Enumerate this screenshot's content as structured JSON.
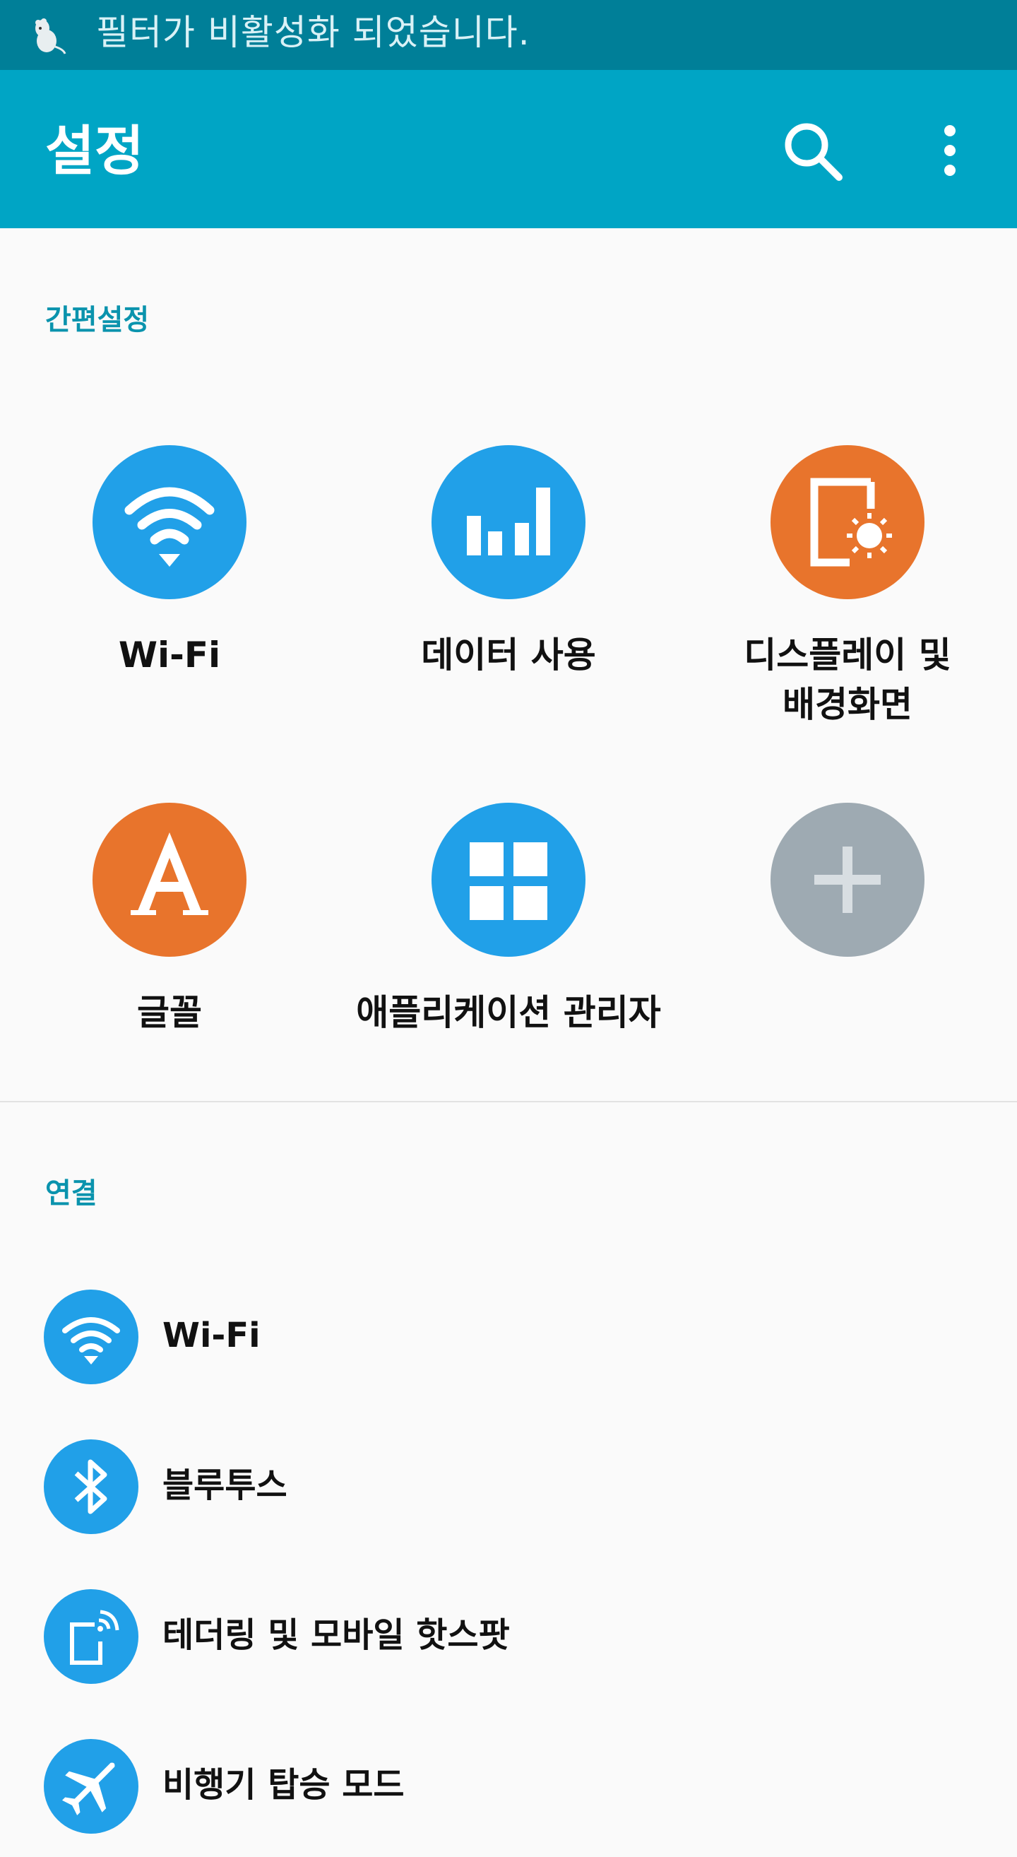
{
  "status_bar": {
    "notification_icon": "moomin-character-icon",
    "notification_text": "필터가 비활성화 되었습니다."
  },
  "app_bar": {
    "title": "설정",
    "search_icon": "search-icon",
    "more_icon": "more-vert-icon"
  },
  "quick_settings": {
    "header": "간편설정",
    "items": [
      {
        "label": "Wi-Fi",
        "icon": "wifi-icon",
        "color": "#21a0e8"
      },
      {
        "label": "데이터 사용",
        "icon": "signal-bars-icon",
        "color": "#21a0e8"
      },
      {
        "label": "디스플레이 및\n배경화면",
        "icon": "display-brightness-icon",
        "color": "#e8742c"
      },
      {
        "label": "글꼴",
        "icon": "font-icon",
        "color": "#e8742c"
      },
      {
        "label": "애플리케이션 관리자",
        "icon": "apps-grid-icon",
        "color": "#21a0e8"
      },
      {
        "label": "",
        "icon": "add-icon",
        "color": "#9eaab2"
      }
    ]
  },
  "connections": {
    "header": "연결",
    "items": [
      {
        "label": "Wi-Fi",
        "icon": "wifi-icon"
      },
      {
        "label": "블루투스",
        "icon": "bluetooth-icon"
      },
      {
        "label": "테더링 및 모바일 핫스팟",
        "icon": "tethering-icon"
      },
      {
        "label": "비행기 탑승 모드",
        "icon": "airplane-icon"
      }
    ],
    "icon_color": "#21a0e8"
  }
}
